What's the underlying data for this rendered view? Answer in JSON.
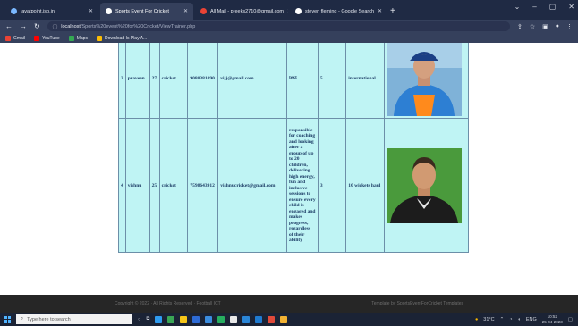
{
  "browser": {
    "tabs": [
      {
        "label": "javatpoint.jsp.in",
        "color": "#7ab8ff"
      },
      {
        "label": "Sports Event For Cricket",
        "color": "#ffffff",
        "active": true
      },
      {
        "label": "All Mail - preeks2710@gmail.com",
        "color": "#ea4335"
      },
      {
        "label": "steven fleming - Google Search",
        "color": "#ffffff"
      }
    ],
    "new_tab": "+",
    "url_host": "localhost",
    "url_path": "/Sports%20event%20for%20Cricket/ViewTrainer.php",
    "bookmarks": [
      {
        "label": "Gmail",
        "color": "#ea4335"
      },
      {
        "label": "YouTube",
        "color": "#ff0000"
      },
      {
        "label": "Maps",
        "color": "#34a853"
      },
      {
        "label": "Download Is Play A...",
        "color": "#fbbc05"
      }
    ]
  },
  "trainers": [
    {
      "id": "3",
      "name": "praveen",
      "age": "27",
      "sport": "cricket",
      "phone": "9080381090",
      "email": "vijj@gmail.com",
      "description": "text",
      "experience": "5",
      "achievement": "international",
      "photo": "trainer-photo-blue-jersey"
    },
    {
      "id": "4",
      "name": "vishnu",
      "age": "25",
      "sport": "cricket",
      "phone": "7598643912",
      "email": "vishnucricket@gmail.com",
      "description": "responsible for coaching and looking after a group of up to 20 children, delivering high energy, fun and inclusive sessions to ensure every child is engaged and makes progress, regardless of their ability",
      "experience": "3",
      "achievement": "10 wickets haul",
      "photo": "trainer-photo-green-background"
    }
  ],
  "footer": {
    "left": "Copyright © 2022 · All Rights Reserved · Football ICT",
    "right": "Template by SportsEventForCricket Templates"
  },
  "taskbar": {
    "search_placeholder": "Type here to search",
    "weather": "31°C",
    "language": "ENG",
    "time": "10:52",
    "date": "25-04-2023"
  }
}
